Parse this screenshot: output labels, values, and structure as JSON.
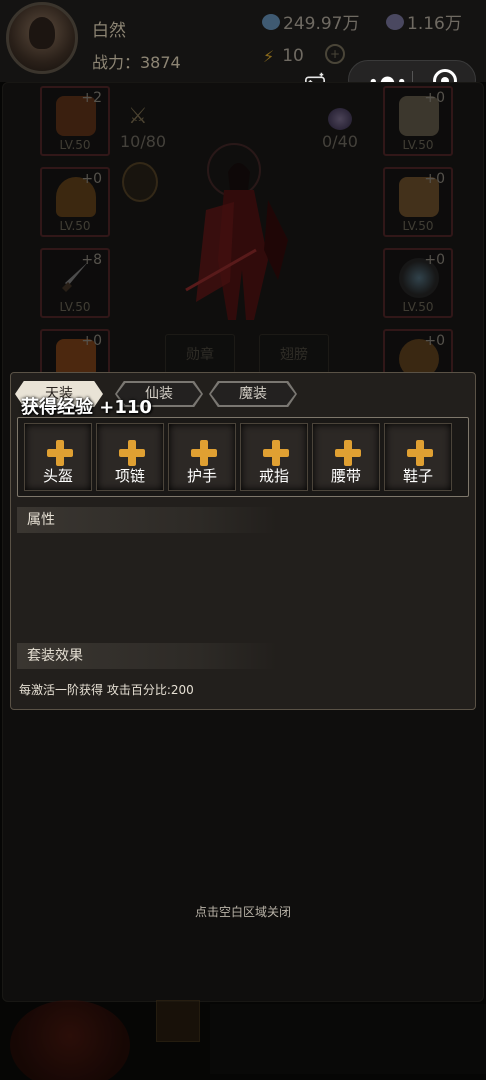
{
  "header": {
    "player_name": "白然",
    "combat_power": "战力：3874",
    "gold": "249.97万",
    "gems": "1.16万",
    "energy": "10",
    "colors": {
      "gold_icon": "#3f5a72",
      "gem_icon": "#4a4860"
    }
  },
  "equipment": {
    "left_slots": [
      {
        "enhance": "+2",
        "level": "LV.50"
      },
      {
        "enhance": "+0",
        "level": "LV.50"
      },
      {
        "enhance": "+8",
        "level": "LV.50"
      },
      {
        "enhance": "+0",
        "level": ""
      }
    ],
    "right_slots": [
      {
        "enhance": "+0",
        "level": "LV.50"
      },
      {
        "enhance": "+0",
        "level": "LV.50"
      },
      {
        "enhance": "+0",
        "level": "LV.50"
      },
      {
        "enhance": "+0",
        "level": ""
      }
    ],
    "wings_counter": "10/80",
    "gem_counter": "0/40",
    "medal_button": "勋章",
    "wings_button": "翅膀"
  },
  "modal": {
    "tabs": [
      "天装",
      "仙装",
      "魔装"
    ],
    "active_tab": "天装",
    "exp_toast": "获得经验 +110",
    "slots": [
      "头盔",
      "项链",
      "护手",
      "戒指",
      "腰带",
      "鞋子"
    ],
    "attributes_title": "属性",
    "set_effect_title": "套装效果",
    "set_effect_text": "每激活一阶获得 攻击百分比:200",
    "accent_color": "#e0a032"
  },
  "close_hint": "点击空白区域关闭"
}
